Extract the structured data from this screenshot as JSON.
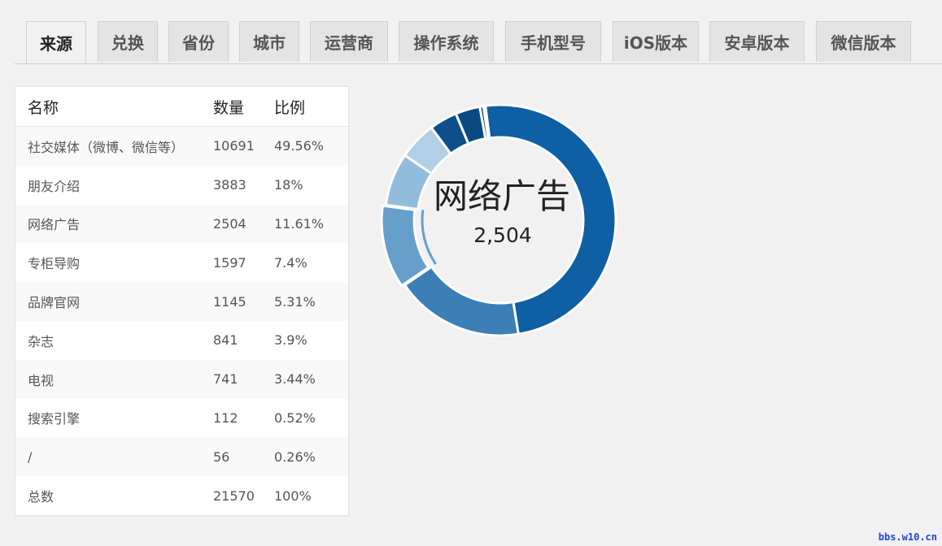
{
  "tabs": [
    "来源",
    "兑换",
    "省份",
    "城市",
    "运营商",
    "操作系统",
    "手机型号",
    "iOS版本",
    "安卓版本",
    "微信版本"
  ],
  "active_tab": 0,
  "table": {
    "headers": [
      "名称",
      "数量",
      "比例"
    ],
    "rows": [
      [
        "社交媒体（微博、微信等）",
        "10691",
        "49.56%"
      ],
      [
        "朋友介绍",
        "3883",
        "18%"
      ],
      [
        "网络广告",
        "2504",
        "11.61%"
      ],
      [
        "专柜导购",
        "1597",
        "7.4%"
      ],
      [
        "品牌官网",
        "1145",
        "5.31%"
      ],
      [
        "杂志",
        "841",
        "3.9%"
      ],
      [
        "电视",
        "741",
        "3.44%"
      ],
      [
        "搜索引擎",
        "112",
        "0.52%"
      ],
      [
        "/",
        "56",
        "0.26%"
      ],
      [
        "总数",
        "21570",
        "100%"
      ]
    ]
  },
  "chart_data": {
    "type": "pie",
    "variant": "donut",
    "categories": [
      "社交媒体（微博、微信等）",
      "朋友介绍",
      "网络广告",
      "专柜导购",
      "品牌官网",
      "杂志",
      "电视",
      "搜索引擎",
      "/"
    ],
    "values": [
      10691,
      3883,
      2504,
      1597,
      1145,
      841,
      741,
      112,
      56
    ],
    "colors": [
      "#0e5fa3",
      "#3b7fb6",
      "#679fcb",
      "#92bcdc",
      "#b1cfe6",
      "#0c4f8a",
      "#0b4a80",
      "#093f6e",
      "#07345c"
    ],
    "highlighted": "网络广告",
    "center_label": "网络广告",
    "center_value": "2,504"
  },
  "watermark": "bbs.w10.cn"
}
